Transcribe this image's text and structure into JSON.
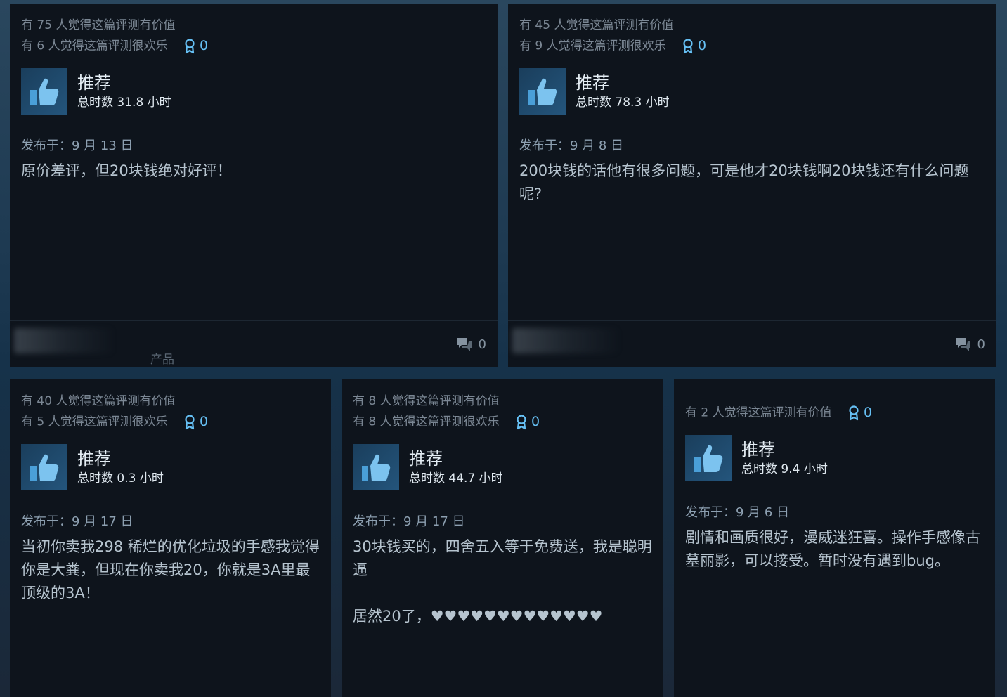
{
  "colors": {
    "accent": "#66c0f4",
    "card_bg": "#0e141c",
    "page_bg": "#1b2838"
  },
  "reviews": [
    {
      "helpful": "有 75 人觉得这篇评测有价值",
      "funny": "有 6 人觉得这篇评测很欢乐",
      "awards": "0",
      "verdict": "推荐",
      "hours": "总时数 31.8 小时",
      "posted": "发布于：9 月 13 日",
      "text": "原价差评，但20块钱绝对好评！",
      "comments": "0",
      "footer_hint": "产品"
    },
    {
      "helpful": "有 45 人觉得这篇评测有价值",
      "funny": "有 9 人觉得这篇评测很欢乐",
      "awards": "0",
      "verdict": "推荐",
      "hours": "总时数 78.3 小时",
      "posted": "发布于：9 月 8 日",
      "text": "200块钱的话他有很多问题，可是他才20块钱啊20块钱还有什么问题呢?",
      "comments": "0"
    },
    {
      "helpful": "有 40 人觉得这篇评测有价值",
      "funny": "有 5 人觉得这篇评测很欢乐",
      "awards": "0",
      "verdict": "推荐",
      "hours": "总时数 0.3 小时",
      "posted": "发布于：9 月 17 日",
      "text": "当初你卖我298 稀烂的优化垃圾的手感我觉得你是大粪，但现在你卖我20，你就是3A里最顶级的3A！"
    },
    {
      "helpful": "有 8 人觉得这篇评测有价值",
      "funny": "有 8 人觉得这篇评测很欢乐",
      "awards": "0",
      "verdict": "推荐",
      "hours": "总时数 44.7 小时",
      "posted": "发布于：9 月 17 日",
      "text": "30块钱买的，四舍五入等于免费送，我是聪明逼\n\n居然20了，♥♥♥♥♥♥♥♥♥♥♥♥♥"
    },
    {
      "helpful": "有 2 人觉得这篇评测有价值",
      "awards": "0",
      "verdict": "推荐",
      "hours": "总时数 9.4 小时",
      "posted": "发布于：9 月 6 日",
      "text": "剧情和画质很好，漫威迷狂喜。操作手感像古墓丽影，可以接受。暂时没有遇到bug。"
    }
  ]
}
